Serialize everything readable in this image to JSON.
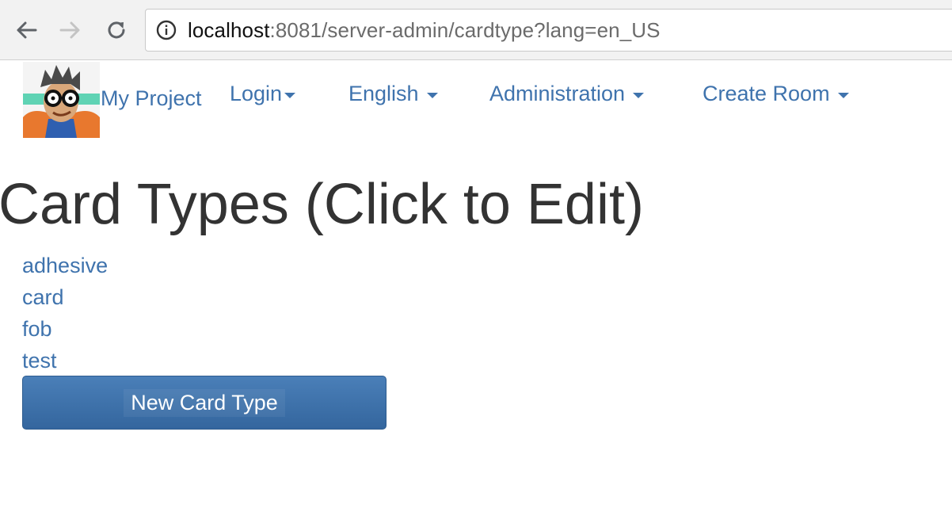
{
  "browser": {
    "url_host": "localhost",
    "url_rest": ":8081/server-admin/cardtype?lang=en_US"
  },
  "navbar": {
    "brand": "My Project",
    "menus": [
      {
        "label": "Login"
      },
      {
        "label": "English"
      },
      {
        "label": "Administration"
      },
      {
        "label": "Create Room"
      }
    ]
  },
  "main": {
    "title": "Card Types (Click to Edit)",
    "card_types": [
      "adhesive",
      "card",
      "fob",
      "test"
    ],
    "new_button": "New Card Type"
  },
  "colors": {
    "link": "#3f73ad",
    "heading": "#333333",
    "button": "#3a6ea8"
  },
  "icons": {
    "back": "back-arrow-icon",
    "forward": "forward-arrow-icon",
    "reload": "reload-icon",
    "info": "info-icon",
    "caret": "caret-down-icon"
  }
}
